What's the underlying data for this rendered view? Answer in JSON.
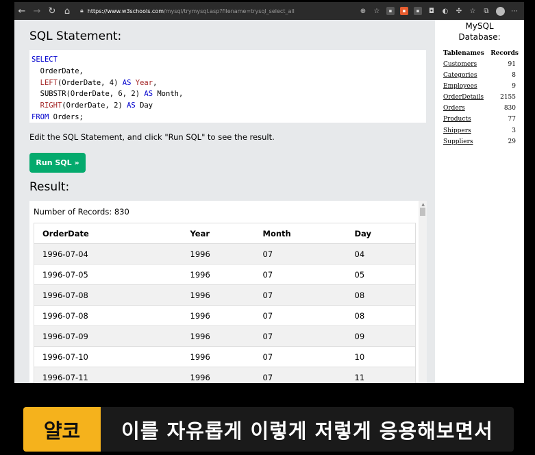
{
  "browser": {
    "url_host": "https://www.w3schools.com",
    "url_path": "/mysql/trymysql.asp?filename=trysql_select_all"
  },
  "editor": {
    "title": "SQL Statement:",
    "code": {
      "l1_kw": "SELECT",
      "l2": "  OrderDate,",
      "l3_fn": "LEFT",
      "l3_mid": "(OrderDate, 4) ",
      "l3_kw": "AS",
      "l3_sp": " ",
      "l3_alias": "Year",
      "l3_end": ",",
      "l4_pre": "  SUBSTR(OrderDate, 6, 2) ",
      "l4_kw": "AS",
      "l4_end": " Month,",
      "l5_fn": "RIGHT",
      "l5_mid": "(OrderDate, 2) ",
      "l5_kw": "AS",
      "l5_end": " Day",
      "l6_kw": "FROM",
      "l6_end": " Orders;"
    },
    "instruction": "Edit the SQL Statement, and click \"Run SQL\" to see the result.",
    "run_label": "Run SQL »"
  },
  "result": {
    "title": "Result:",
    "count_text": "Number of Records: 830",
    "headers": [
      "OrderDate",
      "Year",
      "Month",
      "Day"
    ],
    "rows": [
      [
        "1996-07-04",
        "1996",
        "07",
        "04"
      ],
      [
        "1996-07-05",
        "1996",
        "07",
        "05"
      ],
      [
        "1996-07-08",
        "1996",
        "07",
        "08"
      ],
      [
        "1996-07-08",
        "1996",
        "07",
        "08"
      ],
      [
        "1996-07-09",
        "1996",
        "07",
        "09"
      ],
      [
        "1996-07-10",
        "1996",
        "07",
        "10"
      ],
      [
        "1996-07-11",
        "1996",
        "07",
        "11"
      ]
    ]
  },
  "database": {
    "title_line1": "MySQL",
    "title_line2": "Database:",
    "col_tables": "Tablenames",
    "col_records": "Records",
    "tables": [
      {
        "name": "Customers",
        "records": "91"
      },
      {
        "name": "Categories",
        "records": "8"
      },
      {
        "name": "Employees",
        "records": "9"
      },
      {
        "name": "OrderDetails",
        "records": "2155"
      },
      {
        "name": "Orders",
        "records": "830"
      },
      {
        "name": "Products",
        "records": "77"
      },
      {
        "name": "Shippers",
        "records": "3"
      },
      {
        "name": "Suppliers",
        "records": "29"
      }
    ]
  },
  "subtitle": {
    "speaker": "얄코",
    "text": "이를 자유롭게 이렇게 저렇게 응용해보면서"
  },
  "colors": {
    "run_button": "#04aa6d",
    "speaker_tag": "#f5b21c",
    "keyword": "#0000cd",
    "function": "#a52a2a"
  },
  "icons": [
    "back-icon",
    "forward-icon",
    "reload-icon",
    "home-icon",
    "lock-icon",
    "zoom-icon",
    "favorite-icon",
    "extension-icon",
    "collections-icon",
    "profile-icon",
    "more-icon"
  ]
}
